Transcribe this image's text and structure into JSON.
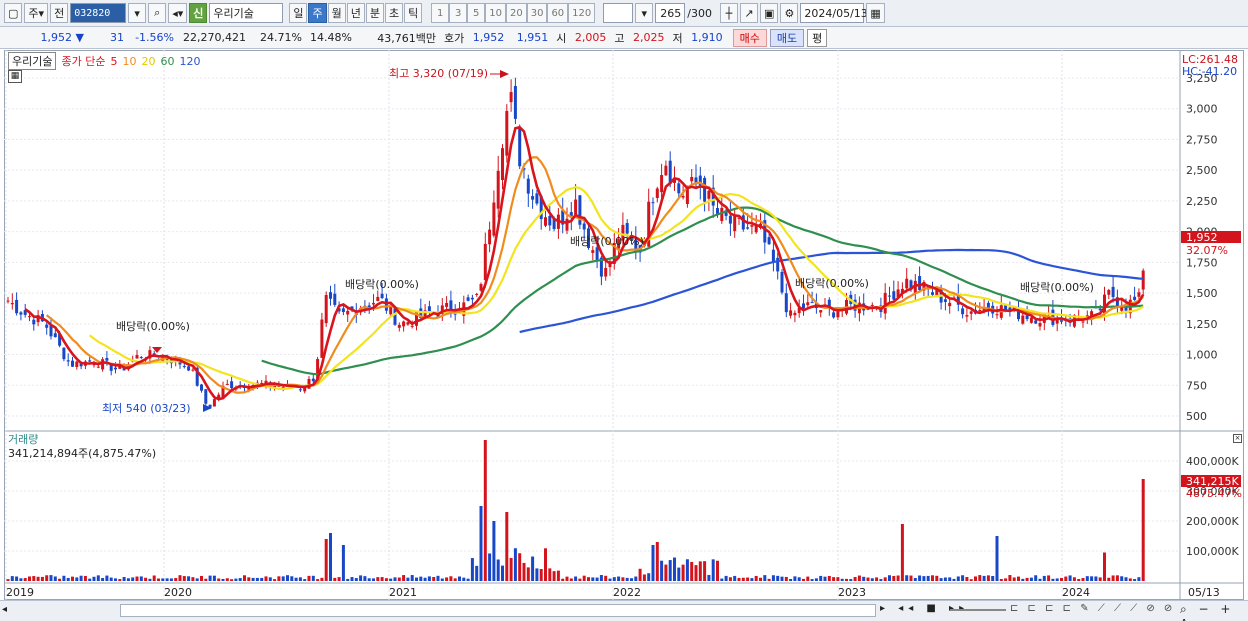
{
  "toolbar": {
    "market": "주",
    "type": "전",
    "code": "032820",
    "stock_name": "우리기술",
    "shin_label": "신",
    "periods": [
      "일",
      "주",
      "월",
      "년",
      "분",
      "초",
      "틱"
    ],
    "active_period": "주",
    "minute_steps": [
      "1",
      "3",
      "5",
      "10",
      "20",
      "30",
      "60",
      "120"
    ],
    "count_value": "265",
    "count_total": "/300",
    "date": "2024/05/13"
  },
  "quote": {
    "price": "1,952",
    "arrow": "▼",
    "change": "31",
    "change_pct": "-1.56%",
    "volume": "22,270,421",
    "vol_ratio": "24.71%",
    "turnover": "14.48%",
    "amount": "43,761백만",
    "hoga_label": "호가",
    "ask": "1,952",
    "bid": "1,951",
    "open_label": "시",
    "open": "2,005",
    "high_label": "고",
    "high": "2,025",
    "low_label": "저",
    "low": "1,910",
    "buy_label": "매수",
    "sell_label": "매도",
    "flat_label": "평"
  },
  "legend": {
    "name": "우리기술",
    "ma_title": "종가 단순",
    "ma5": "5",
    "ma10": "10",
    "ma20": "20",
    "ma60": "60",
    "ma120": "120"
  },
  "price_axis": {
    "ticks": [
      "3,250",
      "3,000",
      "2,750",
      "2,500",
      "2,250",
      "2,000",
      "1,750",
      "1,500",
      "1,250",
      "1,000",
      "750",
      "500"
    ],
    "lc": "LC:261.48",
    "hc": "HC:-41.20",
    "last_price": "1,952",
    "last_pct": "32.07%"
  },
  "annotations": {
    "high": "최고 3,320 (07/19)",
    "low": "최저 540 (03/23)",
    "div1": "배당락(0.00%)",
    "div2": "배당락(0.00%)",
    "div3": "배당락(0.00%)",
    "div4": "배당락(0.00%)",
    "div5": "배당락(0.00%)"
  },
  "volume": {
    "title": "거래량",
    "value": "341,214,894주(4,875.47%)",
    "ticks": [
      "400,000K",
      "300,000K",
      "200,000K",
      "100,000K"
    ],
    "last_value": "341,215K",
    "last_pct": "4875.47%"
  },
  "x_axis": {
    "labels": [
      "2019",
      "2020",
      "2021",
      "2022",
      "2023",
      "2024"
    ],
    "last": "05/13"
  },
  "colors": {
    "ma5": "#d9141c",
    "ma10": "#f08c1e",
    "ma20": "#f2e41e",
    "ma60": "#2f8f4e",
    "ma120": "#2b55d6",
    "up": "#d4141c",
    "down": "#1848c8"
  }
}
